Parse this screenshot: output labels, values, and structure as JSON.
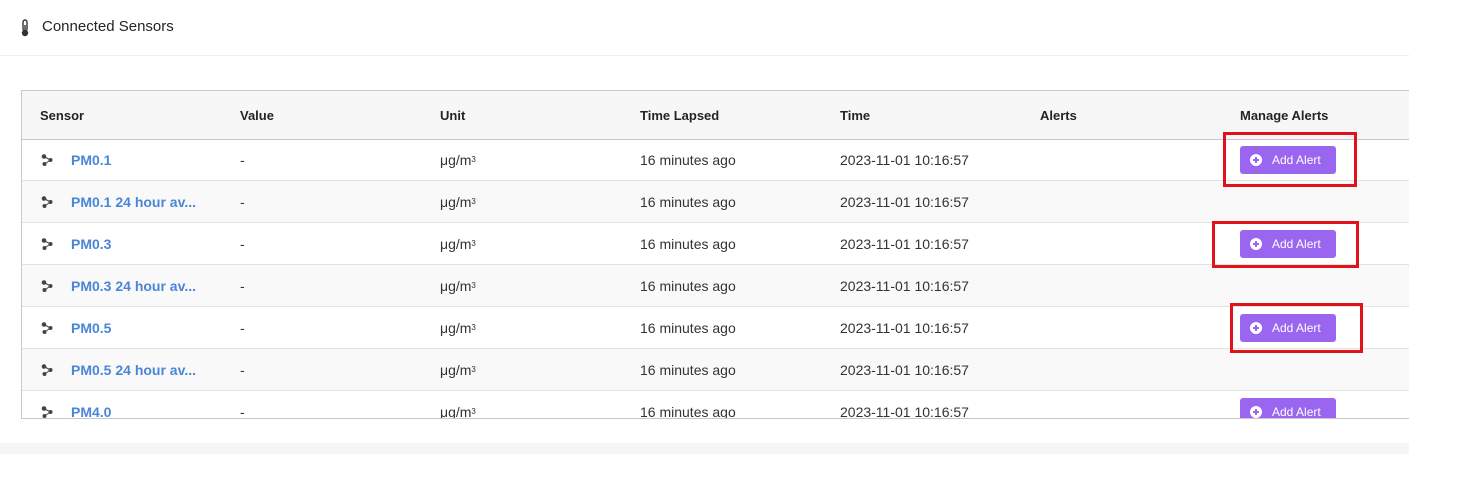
{
  "header": {
    "title": "Connected Sensors",
    "icon": "thermometer-icon"
  },
  "table": {
    "columns": [
      "Sensor",
      "Value",
      "Unit",
      "Time Lapsed",
      "Time",
      "Alerts",
      "Manage Alerts"
    ],
    "rows": [
      {
        "sensor": "PM0.1",
        "value": "-",
        "unit": "μg/m",
        "unit_sup": "3",
        "lapsed": "16 minutes ago",
        "time": "2023-11-01 10:16:57",
        "alerts": "",
        "button": "Add Alert"
      },
      {
        "sensor": "PM0.1 24 hour av...",
        "value": "-",
        "unit": "μg/m",
        "unit_sup": "3",
        "lapsed": "16 minutes ago",
        "time": "2023-11-01 10:16:57",
        "alerts": "",
        "button": ""
      },
      {
        "sensor": "PM0.3",
        "value": "-",
        "unit": "μg/m",
        "unit_sup": "3",
        "lapsed": "16 minutes ago",
        "time": "2023-11-01 10:16:57",
        "alerts": "",
        "button": "Add Alert"
      },
      {
        "sensor": "PM0.3 24 hour av...",
        "value": "-",
        "unit": "μg/m",
        "unit_sup": "3",
        "lapsed": "16 minutes ago",
        "time": "2023-11-01 10:16:57",
        "alerts": "",
        "button": ""
      },
      {
        "sensor": "PM0.5",
        "value": "-",
        "unit": "μg/m",
        "unit_sup": "3",
        "lapsed": "16 minutes ago",
        "time": "2023-11-01 10:16:57",
        "alerts": "",
        "button": "Add Alert"
      },
      {
        "sensor": "PM0.5 24 hour av...",
        "value": "-",
        "unit": "μg/m",
        "unit_sup": "3",
        "lapsed": "16 minutes ago",
        "time": "2023-11-01 10:16:57",
        "alerts": "",
        "button": ""
      },
      {
        "sensor": "PM4.0",
        "value": "-",
        "unit": "μg/m",
        "unit_sup": "3",
        "lapsed": "16 minutes ago",
        "time": "2023-11-01 10:16:57",
        "alerts": "",
        "button": "Add Alert"
      }
    ]
  },
  "colors": {
    "accent_button": "#9a66f0",
    "sensor_link": "#4a86d8",
    "highlight": "#e0131c"
  }
}
